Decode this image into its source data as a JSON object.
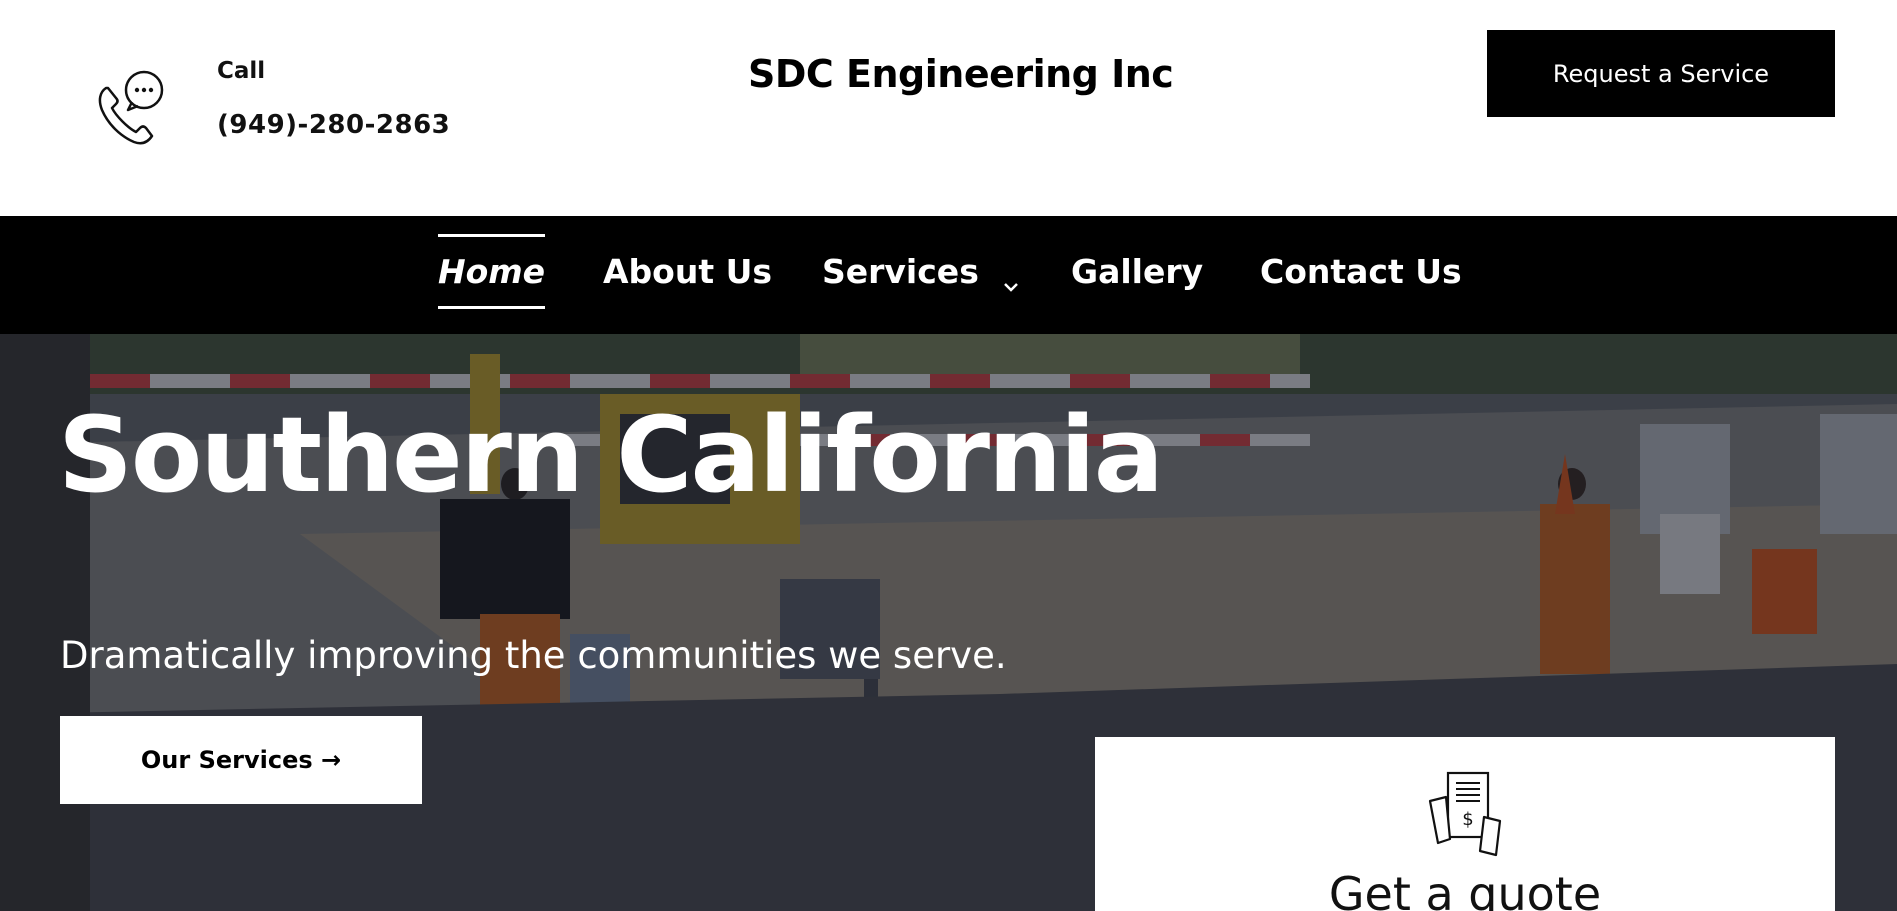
{
  "header": {
    "call_label": "Call",
    "phone_number": "(949)-280-2863",
    "site_title": "SDC Engineering Inc",
    "request_button": "Request a Service",
    "icon": "phone-chat-icon"
  },
  "nav": {
    "items": [
      {
        "label": "Home",
        "active": true
      },
      {
        "label": "About Us",
        "active": false
      },
      {
        "label": "Services",
        "active": false,
        "dropdown": true
      },
      {
        "label": "Gallery",
        "active": false
      },
      {
        "label": "Contact Us",
        "active": false
      }
    ]
  },
  "hero": {
    "title": "Southern California",
    "subtitle": "Dramatically improving the communities we serve.",
    "cta_button": "Our Services →"
  },
  "quote_card": {
    "icon": "invoice-dollar-icon",
    "title": "Get a quote"
  },
  "colors": {
    "primary": "#000000",
    "background": "#ffffff",
    "text_on_dark": "#ffffff"
  }
}
